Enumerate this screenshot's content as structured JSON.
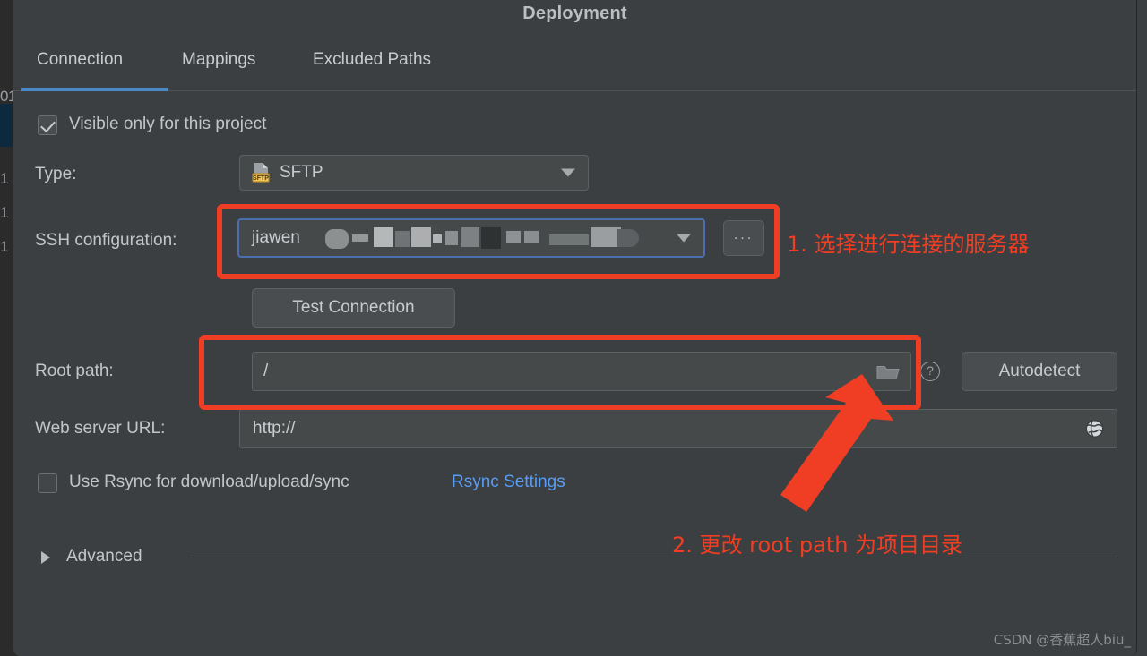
{
  "window": {
    "title": "Deployment"
  },
  "background_editor": {
    "gutter_numbers": [
      "01",
      "1",
      "1",
      "1"
    ]
  },
  "tabs": [
    {
      "label": "Connection",
      "active": true
    },
    {
      "label": "Mappings",
      "active": false
    },
    {
      "label": "Excluded Paths",
      "active": false
    }
  ],
  "form": {
    "visible_only_checkbox": {
      "label": "Visible only for this project",
      "checked": true
    },
    "type": {
      "label": "Type:",
      "value": "SFTP",
      "icon": "sftp-file-icon"
    },
    "ssh_configuration": {
      "label": "SSH configuration:",
      "value": "jiawen",
      "value_redacted_suffix": "██████████",
      "browse_button": "...",
      "focused": true
    },
    "test_connection_button": {
      "label": "Test Connection"
    },
    "root_path": {
      "label": "Root path:",
      "value": "/",
      "folder_icon": "folder-icon",
      "help_icon": "help-circle-icon",
      "autodetect_button": "Autodetect"
    },
    "web_server_url": {
      "label": "Web server URL:",
      "value": "http://",
      "globe_icon": "globe-icon"
    },
    "rsync": {
      "checkbox_label": "Use Rsync for download/upload/sync",
      "checked": false,
      "settings_link": "Rsync Settings"
    },
    "advanced": {
      "label": "Advanced",
      "expanded": false
    }
  },
  "annotations": [
    {
      "id": "step-1",
      "text": "1. 选择进行连接的服务器"
    },
    {
      "id": "step-2",
      "text": "2. 更改 root path 为项目目录"
    }
  ],
  "watermark": {
    "text": "CSDN @香蕉超人biu_"
  },
  "colors": {
    "dialog_bg": "#3c3f41",
    "field_bg": "#45494a",
    "text": "#c9ccce",
    "accent_blue": "#4a88c7",
    "link_blue": "#589df6",
    "annotation_red": "#ef3e23",
    "focus_border": "#4b6eaf",
    "sftp_badge": "#d6a540"
  }
}
